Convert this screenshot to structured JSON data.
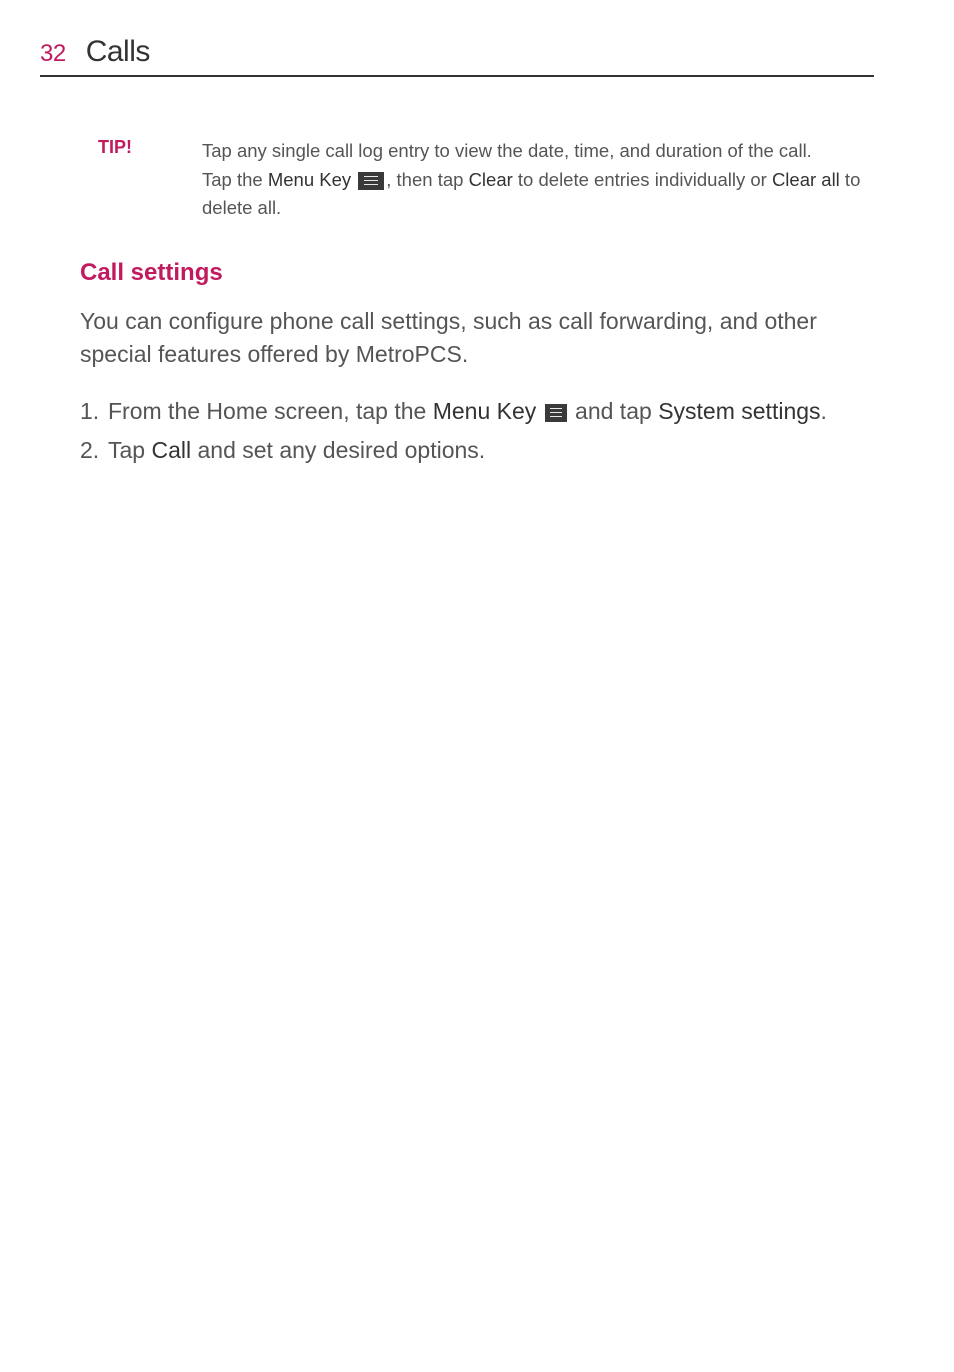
{
  "header": {
    "page_number": "32",
    "title": "Calls"
  },
  "tip": {
    "label": "TIP!",
    "line1": "Tap any single call log entry to view the date, time, and duration of the call.",
    "line2_a": "Tap the ",
    "line2_menu_key": "Menu Key",
    "line2_b": ", then tap ",
    "line2_clear": "Clear",
    "line2_c": " to delete entries individually or ",
    "line2_clear_all": "Clear all",
    "line2_d": " to delete all."
  },
  "section": {
    "heading": "Call settings",
    "intro": "You can configure phone call settings, such as call forwarding, and other special features offered by MetroPCS."
  },
  "steps": [
    {
      "num": "1.",
      "a": "From the Home screen, tap the ",
      "menu_key": "Menu Key",
      "b": " and tap ",
      "system_settings": "System settings",
      "c": "."
    },
    {
      "num": "2.",
      "a": "Tap ",
      "call": "Call",
      "b": " and set any desired options."
    }
  ]
}
